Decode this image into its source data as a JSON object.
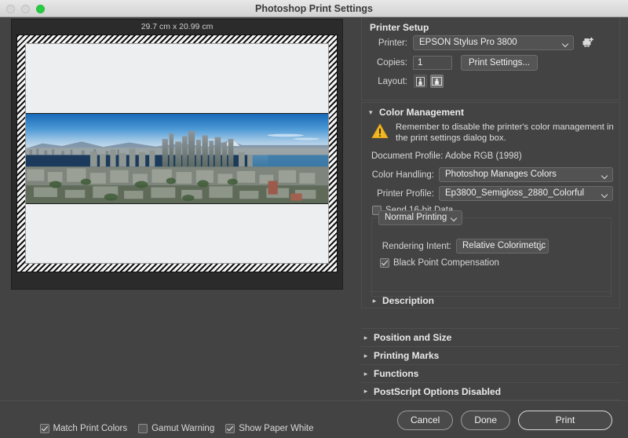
{
  "window": {
    "title": "Photoshop Print Settings",
    "traffic_lights": [
      "close",
      "minimize",
      "zoom"
    ]
  },
  "preview": {
    "size_label": "29.7 cm x 20.99 cm",
    "image_description": "Seattle downtown skyline panorama with blue sky and waterfront"
  },
  "printer_setup": {
    "title": "Printer Setup",
    "printer_label": "Printer:",
    "printer_value": "EPSON Stylus Pro 3800",
    "add_printer_icon": "printer-add-icon",
    "copies_label": "Copies:",
    "copies_value": "1",
    "print_settings_button": "Print Settings...",
    "layout_label": "Layout:",
    "layout_options": [
      {
        "name": "portrait",
        "selected": false
      },
      {
        "name": "landscape",
        "selected": true
      }
    ]
  },
  "color_management": {
    "title": "Color Management",
    "expanded": true,
    "warning_icon": "warning-triangle-icon",
    "warning_color": "#f0b624",
    "warning_text": "Remember to disable the printer's color management in the print settings dialog box.",
    "document_profile": "Document Profile: Adobe RGB (1998)",
    "color_handling_label": "Color Handling:",
    "color_handling_value": "Photoshop Manages Colors",
    "printer_profile_label": "Printer Profile:",
    "printer_profile_value": "Ep3800_Semigloss_2880_Colorful",
    "send_16bit_label": "Send 16-bit Data",
    "send_16bit_checked": false,
    "print_mode_value": "Normal Printing",
    "rendering_intent_label": "Rendering Intent:",
    "rendering_intent_value": "Relative Colorimetric",
    "black_point_label": "Black Point Compensation",
    "black_point_checked": true,
    "description_label": "Description"
  },
  "sections": [
    {
      "label": "Position and Size",
      "expanded": false
    },
    {
      "label": "Printing Marks",
      "expanded": false
    },
    {
      "label": "Functions",
      "expanded": false
    },
    {
      "label": "PostScript Options Disabled",
      "expanded": false
    }
  ],
  "bottom_checks": [
    {
      "label": "Match Print Colors",
      "checked": true
    },
    {
      "label": "Gamut Warning",
      "checked": false
    },
    {
      "label": "Show Paper White",
      "checked": true
    }
  ],
  "footer": {
    "cancel": "Cancel",
    "done": "Done",
    "print": "Print"
  }
}
